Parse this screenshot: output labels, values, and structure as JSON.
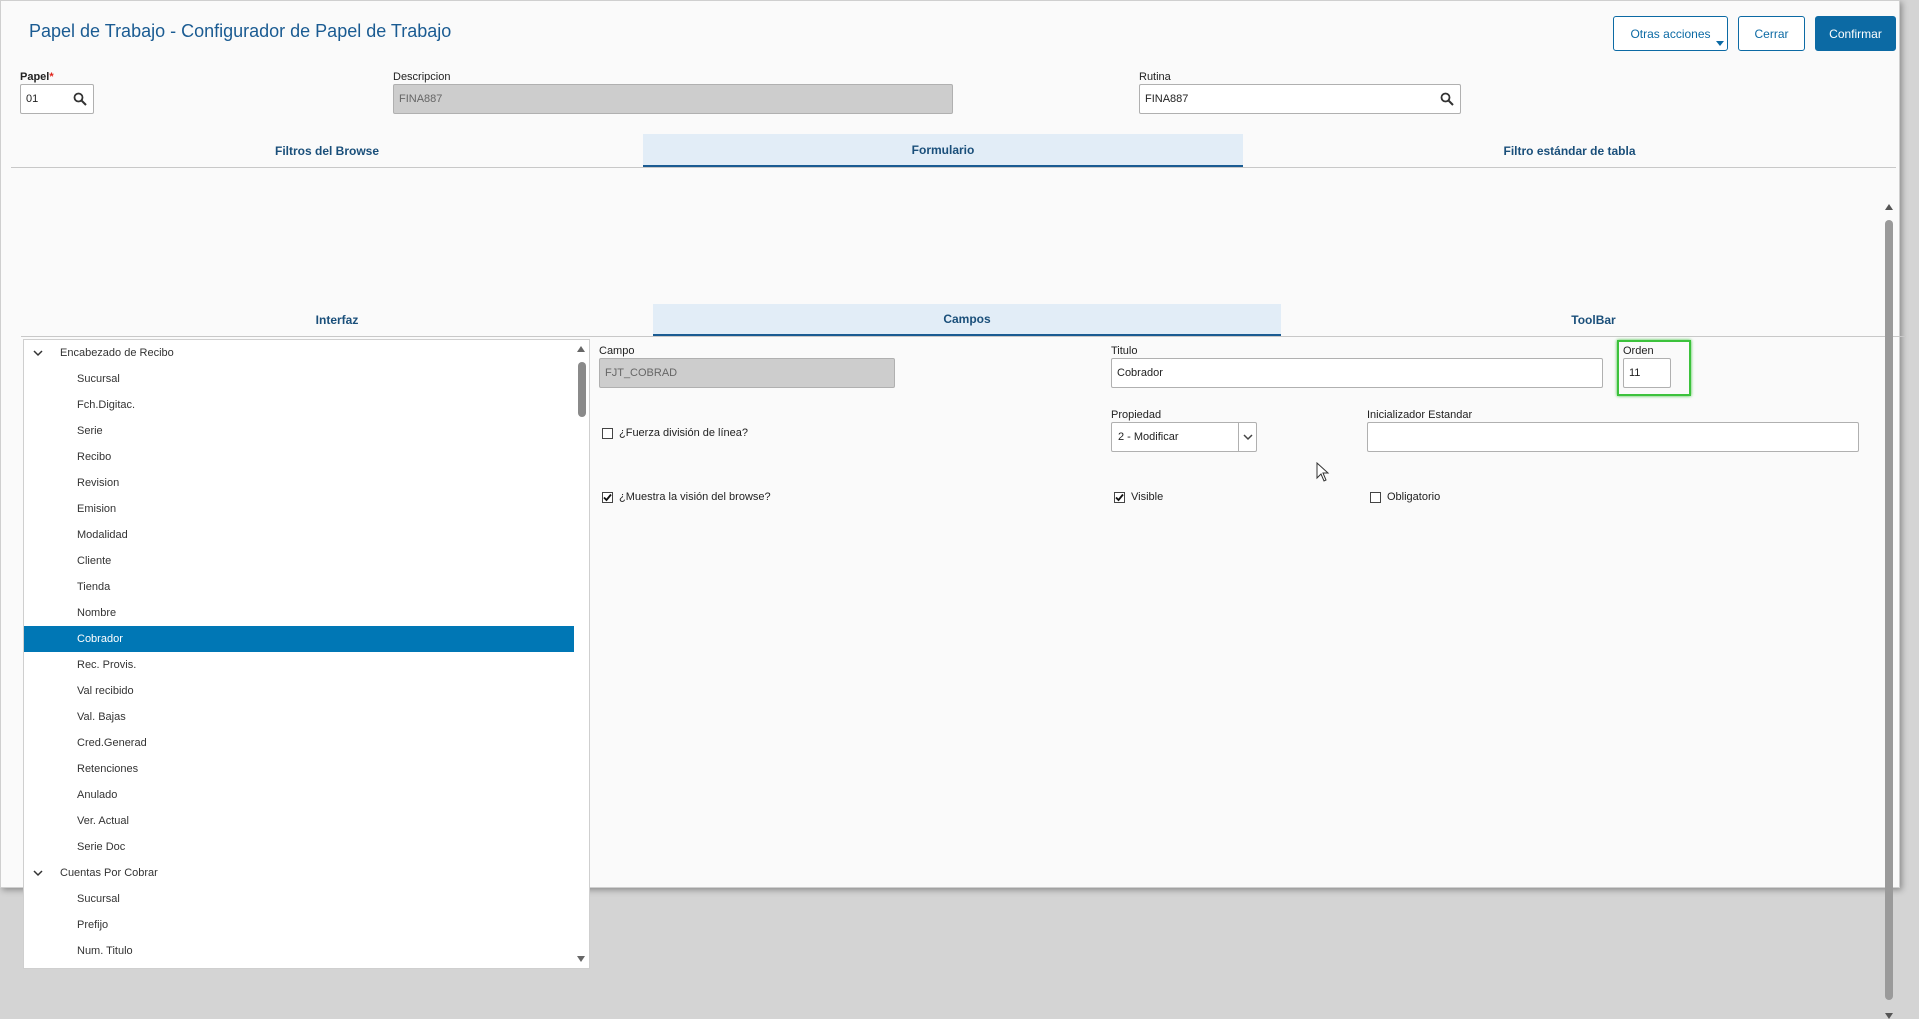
{
  "window": {
    "title": "Papel de Trabajo - Configurador de Papel de Trabajo"
  },
  "toolbar": {
    "other_actions_label": "Otras acciones",
    "close_label": "Cerrar",
    "confirm_label": "Confirmar"
  },
  "header_form": {
    "papel_label": "Papel",
    "papel_required_mark": "*",
    "papel_value": "01",
    "descripcion_label": "Descripcion",
    "descripcion_value": "FINA887",
    "rutina_label": "Rutina",
    "rutina_value": "FINA887"
  },
  "tabs_level1": [
    {
      "label": "Filtros del Browse",
      "active": false
    },
    {
      "label": "Formulario",
      "active": true
    },
    {
      "label": "Filtro estándar de tabla",
      "active": false
    }
  ],
  "tabs_level2": [
    {
      "label": "Interfaz",
      "active": false
    },
    {
      "label": "Campos",
      "active": true
    },
    {
      "label": "ToolBar",
      "active": false
    }
  ],
  "tree": {
    "groups": [
      {
        "label": "Encabezado de Recibo",
        "items": [
          "Sucursal",
          "Fch.Digitac.",
          "Serie",
          "Recibo",
          "Revision",
          "Emision",
          "Modalidad",
          "Cliente",
          "Tienda",
          "Nombre",
          "Cobrador",
          "Rec. Provis.",
          "Val recibido",
          "Val. Bajas",
          "Cred.Generad",
          "Retenciones",
          "Anulado",
          "Ver. Actual",
          "Serie Doc"
        ]
      },
      {
        "label": "Cuentas Por Cobrar",
        "items": [
          "Sucursal",
          "Prefijo",
          "Num. Titulo"
        ]
      }
    ],
    "selected": "Cobrador"
  },
  "detail": {
    "campo_label": "Campo",
    "campo_value": "FJT_COBRAD",
    "titulo_label": "Titulo",
    "titulo_value": "Cobrador",
    "orden_label": "Orden",
    "orden_value": "11",
    "fuerza_label": "¿Fuerza división de línea?",
    "fuerza_checked": false,
    "propiedad_label": "Propiedad",
    "propiedad_value": "2 - Modificar",
    "inicializador_label": "Inicializador Estandar",
    "inicializador_value": "",
    "muestra_label": "¿Muestra la visión del browse?",
    "muestra_checked": true,
    "visible_label": "Visible",
    "visible_checked": true,
    "obligatorio_label": "Obligatorio",
    "obligatorio_checked": false
  },
  "colors": {
    "accent": "#0c6aa4",
    "selected_row": "#0077b5",
    "highlight": "#3cc23c",
    "title": "#1a5b92"
  }
}
